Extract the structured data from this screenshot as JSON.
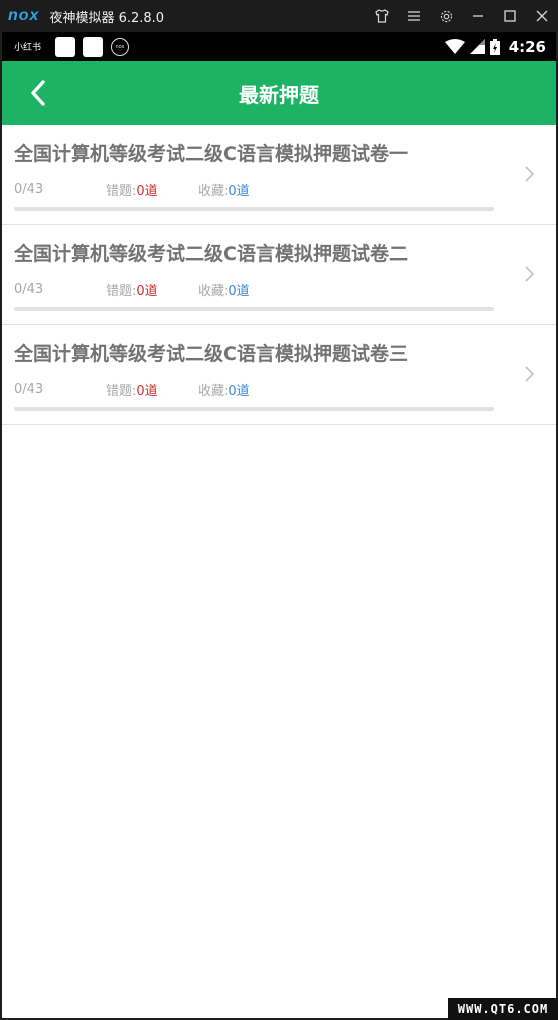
{
  "emulator": {
    "logo": "nox",
    "title": "夜神模拟器 6.2.8.0",
    "icons": [
      "shirt-icon",
      "menu-icon",
      "gear-icon",
      "minimize-icon",
      "maximize-icon",
      "close-icon"
    ]
  },
  "status_bar": {
    "app_label": "小红书",
    "nox_label": "nox",
    "time": "4:26"
  },
  "header": {
    "title": "最新押题",
    "back_icon": "chevron-left-icon"
  },
  "papers": [
    {
      "title": "全国计算机等级考试二级C语言模拟押题试卷一",
      "progress": "0/43",
      "progress_fraction": 0,
      "wrong_label": "错题:",
      "wrong_value": "0道",
      "fav_label": "收藏:",
      "fav_value": "0道"
    },
    {
      "title": "全国计算机等级考试二级C语言模拟押题试卷二",
      "progress": "0/43",
      "progress_fraction": 0,
      "wrong_label": "错题:",
      "wrong_value": "0道",
      "fav_label": "收藏:",
      "fav_value": "0道"
    },
    {
      "title": "全国计算机等级考试二级C语言模拟押题试卷三",
      "progress": "0/43",
      "progress_fraction": 0,
      "wrong_label": "错题:",
      "wrong_value": "0道",
      "fav_label": "收藏:",
      "fav_value": "0道"
    }
  ],
  "colors": {
    "accent": "#1db364",
    "wrong": "#c9312c",
    "fav": "#3a8ad8"
  },
  "watermark": "WWW.QT6.COM"
}
